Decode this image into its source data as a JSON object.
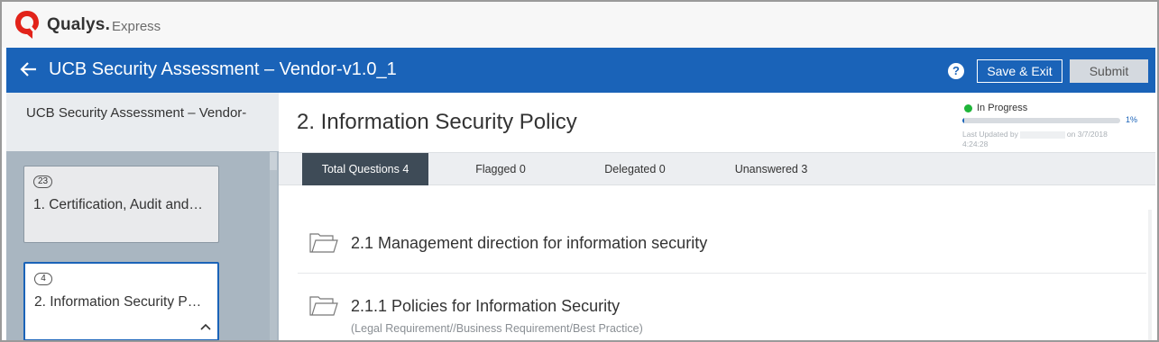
{
  "brand": {
    "name": "Qualys.",
    "product": "Express"
  },
  "header": {
    "title": "UCB Security Assessment – Vendor-v1.0_1",
    "help": "?",
    "save_label": "Save & Exit",
    "submit_label": "Submit"
  },
  "sidebar": {
    "title": "UCB Security Assessment – Vendor-",
    "cards": [
      {
        "count": "23",
        "label": "1. Certification, Audit and…"
      },
      {
        "count": "4",
        "label": "2. Information Security P…"
      }
    ]
  },
  "main": {
    "title": "2. Information Security Policy",
    "status": {
      "label": "In Progress",
      "percent_label": "1%",
      "progress": 0.01,
      "updated_prefix": "Last Updated by",
      "updated_suffix": "on 3/7/2018",
      "updated_time": "4:24:28"
    },
    "tabs": [
      {
        "label": "Total Questions 4"
      },
      {
        "label": "Flagged 0"
      },
      {
        "label": "Delegated 0"
      },
      {
        "label": "Unanswered 3"
      }
    ],
    "sections": [
      {
        "title": "2.1 Management direction for information security"
      },
      {
        "title": "2.1.1 Policies for Information Security",
        "subtitle": "(Legal Requirement//Business Requirement/Best Practice)"
      }
    ]
  },
  "colors": {
    "header_blue": "#1a63b8",
    "sidebar": "#a9b6c1",
    "active_tab": "#3e4b57",
    "status_green": "#1fb539"
  },
  "icons": [
    "qualys-logo-icon",
    "back-arrow-icon",
    "help-icon",
    "folder-icon",
    "chevron-up-icon"
  ]
}
